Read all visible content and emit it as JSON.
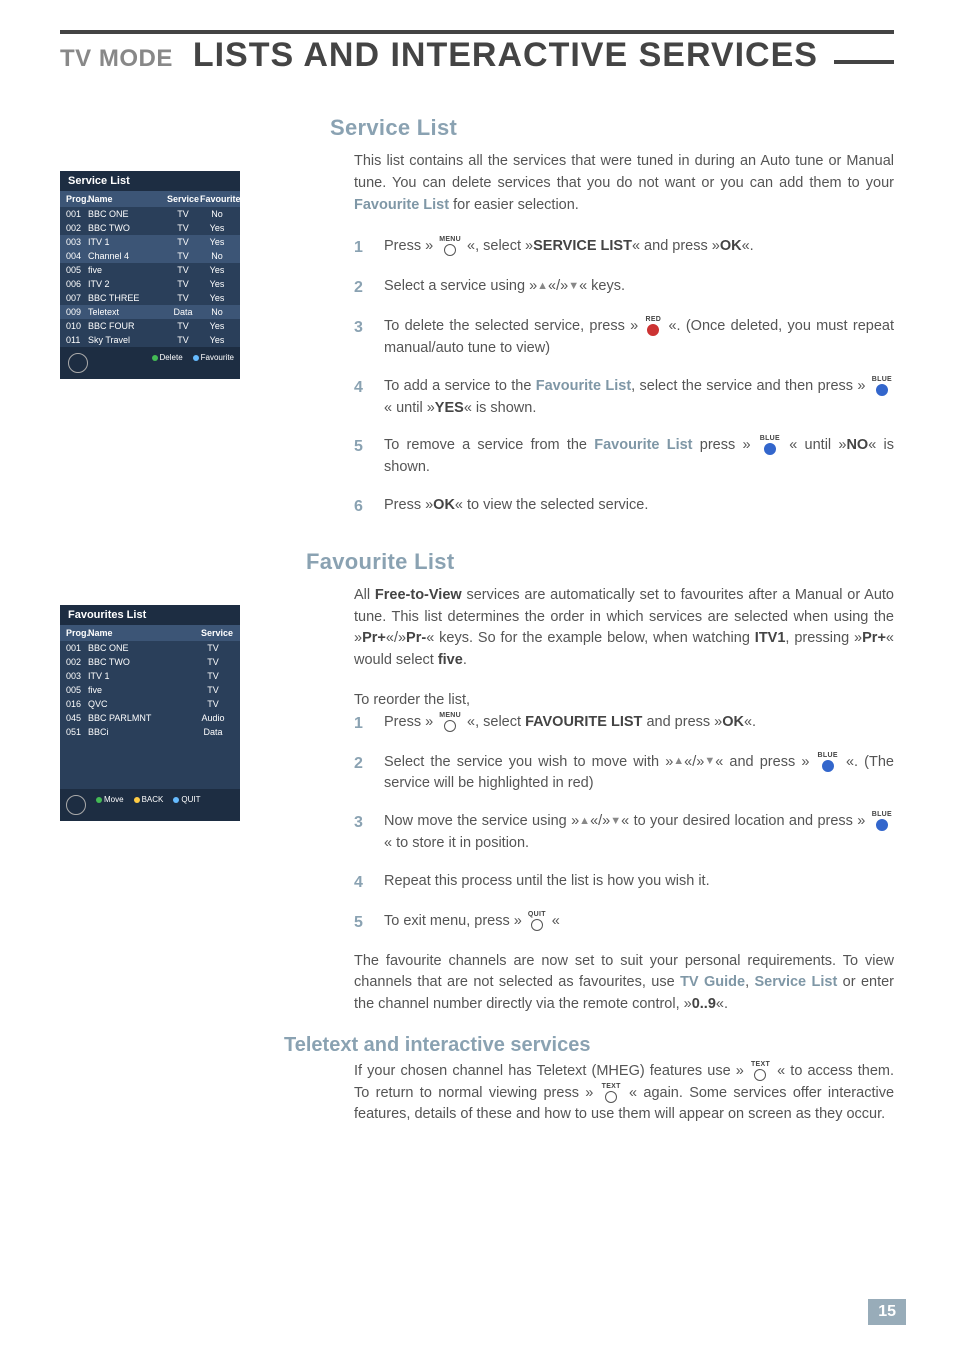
{
  "header": {
    "side_label": "TV MODE",
    "main_title": "LISTS AND INTERACTIVE SERVICES"
  },
  "page_number": "15",
  "sections": {
    "service_list": {
      "title": "Service List",
      "intro_a": "This list contains all the services that were tuned in during an Auto tune or Manual tune. You can delete services that you do not want or you can add them to your ",
      "intro_b_bold": "Favourite List",
      "intro_c": " for easier selection.",
      "steps": [
        {
          "num": "1",
          "parts": [
            "Press » ",
            {
              "btn": "MENU"
            },
            " «, select »",
            {
              "b": "SERVICE LIST"
            },
            "« and press »",
            {
              "b": "OK"
            },
            "«."
          ]
        },
        {
          "num": "2",
          "parts": [
            "Select a service using »",
            {
              "up": true
            },
            "«/»",
            {
              "down": true
            },
            "« keys."
          ]
        },
        {
          "num": "3",
          "parts": [
            "To delete the selected service, press » ",
            {
              "btn": "RED",
              "color": "red"
            },
            " «. (Once deleted, you must repeat manual/auto tune to view)"
          ]
        },
        {
          "num": "4",
          "parts": [
            "To add a service to the ",
            {
              "eb": "Favourite List"
            },
            ", select the service and then press » ",
            {
              "btn": "BLUE",
              "color": "blue"
            },
            " « until »",
            {
              "b": "YES"
            },
            "« is shown."
          ]
        },
        {
          "num": "5",
          "parts": [
            "To remove a service from the ",
            {
              "eb": "Favourite List"
            },
            " press » ",
            {
              "btn": "BLUE",
              "color": "blue"
            },
            " « until »",
            {
              "b": "NO"
            },
            "« is shown."
          ]
        },
        {
          "num": "6",
          "parts": [
            "Press »",
            {
              "b": "OK"
            },
            "« to view the selected service."
          ]
        }
      ]
    },
    "favourite_list": {
      "title": "Favourite List",
      "intro_parts": [
        "All ",
        {
          "b": "Free-to-View"
        },
        " services are automatically set to favourites after a Manual or Auto tune. This list determines the order in which services are selected when using the »",
        {
          "b": "Pr+"
        },
        "«/»",
        {
          "b": "Pr-"
        },
        "« keys. So for the example below, when watching ",
        {
          "b": "ITV1"
        },
        ", pressing »",
        {
          "b": "Pr+"
        },
        "« would select ",
        {
          "b": "five"
        },
        "."
      ],
      "reorder_label": "To reorder the list,",
      "steps": [
        {
          "num": "1",
          "parts": [
            "Press » ",
            {
              "btn": "MENU"
            },
            " «, select ",
            {
              "b": "FAVOURITE LIST"
            },
            " and press »",
            {
              "b": "OK"
            },
            "«."
          ]
        },
        {
          "num": "2",
          "parts": [
            "Select the service you wish to move with »",
            {
              "up": true
            },
            "«/»",
            {
              "down": true
            },
            "« and press » ",
            {
              "btn": "BLUE",
              "color": "blue"
            },
            " «. (The service will be highlighted in red)"
          ]
        },
        {
          "num": "3",
          "parts": [
            "Now move the service using »",
            {
              "up": true
            },
            "«/»",
            {
              "down": true
            },
            "« to your desired location and press » ",
            {
              "btn": "BLUE",
              "color": "blue"
            },
            " « to store it in position."
          ]
        },
        {
          "num": "4",
          "parts": [
            "Repeat this process until the list is how you wish it."
          ]
        },
        {
          "num": "5",
          "parts": [
            "To exit menu, press » ",
            {
              "btn": "QUIT"
            },
            " «"
          ]
        }
      ],
      "outro_parts": [
        "The favourite channels are now set to suit your personal requirements. To view channels that are not selected as favourites, use ",
        {
          "eb": "TV Guide"
        },
        ", ",
        {
          "eb": "Service List"
        },
        " or enter the channel number directly via the remote control, »",
        {
          "b": "0..9"
        },
        "«."
      ]
    },
    "teletext": {
      "title": "Teletext and interactive services",
      "body_parts": [
        "If your chosen channel has Teletext (MHEG) features use » ",
        {
          "btn": "TEXT"
        },
        " « to access them. To return to normal viewing press » ",
        {
          "btn": "TEXT"
        },
        " « again. Some services offer interactive features, details of these and how to use them will appear on screen as they occur."
      ]
    }
  },
  "osd_service_list": {
    "title": "Service List",
    "headers": [
      "Prog.",
      "Name",
      "Service",
      "Favourite"
    ],
    "rows": [
      {
        "p": "001",
        "n": "BBC ONE",
        "s": "TV",
        "f": "No",
        "sel": false
      },
      {
        "p": "002",
        "n": "BBC TWO",
        "s": "TV",
        "f": "Yes",
        "sel": false
      },
      {
        "p": "003",
        "n": "ITV 1",
        "s": "TV",
        "f": "Yes",
        "sel": true
      },
      {
        "p": "004",
        "n": "Channel 4",
        "s": "TV",
        "f": "No",
        "sel": true
      },
      {
        "p": "005",
        "n": "five",
        "s": "TV",
        "f": "Yes",
        "sel": false
      },
      {
        "p": "006",
        "n": "ITV 2",
        "s": "TV",
        "f": "Yes",
        "sel": false
      },
      {
        "p": "007",
        "n": "BBC THREE",
        "s": "TV",
        "f": "Yes",
        "sel": false
      },
      {
        "p": "009",
        "n": "Teletext",
        "s": "Data",
        "f": "No",
        "sel": true
      },
      {
        "p": "010",
        "n": "BBC FOUR",
        "s": "TV",
        "f": "Yes",
        "sel": false
      },
      {
        "p": "011",
        "n": "Sky Travel",
        "s": "TV",
        "f": "Yes",
        "sel": false
      }
    ],
    "footer": [
      "Delete",
      "Favourite"
    ]
  },
  "osd_favourites": {
    "title": "Favourites List",
    "headers": [
      "Prog.",
      "Name",
      "Service"
    ],
    "rows": [
      {
        "p": "001",
        "n": "BBC ONE",
        "s": "TV"
      },
      {
        "p": "002",
        "n": "BBC TWO",
        "s": "TV"
      },
      {
        "p": "003",
        "n": "ITV 1",
        "s": "TV"
      },
      {
        "p": "005",
        "n": "five",
        "s": "TV"
      },
      {
        "p": "016",
        "n": "QVC",
        "s": "TV"
      },
      {
        "p": "045",
        "n": "BBC PARLMNT",
        "s": "Audio"
      },
      {
        "p": "051",
        "n": "BBCi",
        "s": "Data"
      }
    ],
    "footer": [
      "Move",
      "BACK",
      "QUIT"
    ]
  }
}
